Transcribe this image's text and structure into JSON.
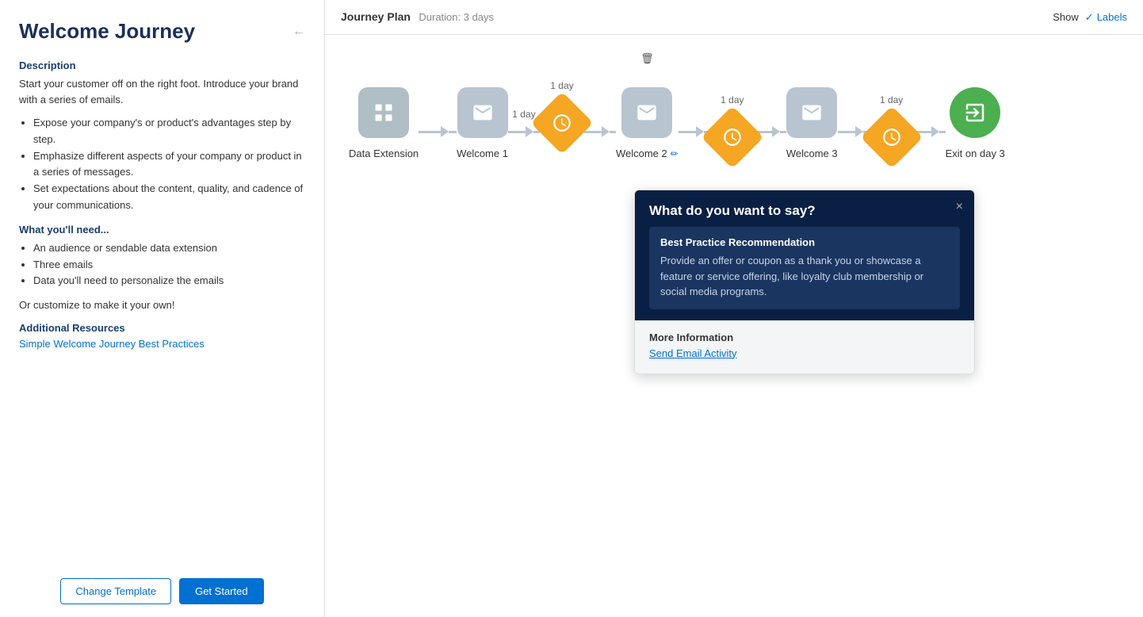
{
  "leftPanel": {
    "title": "Welcome Journey",
    "backArrow": "←",
    "descriptionHeading": "Description",
    "descriptionText": "Start your customer off on the right foot. Introduce your brand with a series of emails.",
    "bullets": [
      "Expose your company's or product's advantages step by step.",
      "Emphasize different aspects of your company or product in a series of messages.",
      "Set expectations about the content, quality, and cadence of your communications."
    ],
    "whatYoullNeed": "What you'll need...",
    "needsBullets": [
      "An audience or sendable data extension",
      "Three emails",
      "Data you'll need to personalize the emails"
    ],
    "customizeText": "Or customize to make it your own!",
    "additionalResourcesHeading": "Additional Resources",
    "resourceLink": "Simple Welcome Journey Best Practices",
    "changeTemplateLabel": "Change Template",
    "getStartedLabel": "Get Started"
  },
  "header": {
    "journeyPlanLabel": "Journey Plan",
    "durationLabel": "Duration: 3 days",
    "showLabel": "Show",
    "labelsLabel": "Labels"
  },
  "flow": {
    "nodes": [
      {
        "id": "data-extension",
        "type": "gray",
        "label": "Data Extension",
        "dayAbove": ""
      },
      {
        "id": "welcome-1",
        "type": "email",
        "label": "Welcome 1",
        "dayAbove": ""
      },
      {
        "id": "wait-1",
        "type": "diamond",
        "label": "",
        "dayAbove": "1 day"
      },
      {
        "id": "welcome-2",
        "type": "email",
        "label": "Welcome 2",
        "dayAbove": "",
        "editable": true,
        "hasDelete": true
      },
      {
        "id": "wait-2",
        "type": "diamond",
        "label": "",
        "dayAbove": "1 day"
      },
      {
        "id": "welcome-3",
        "type": "email",
        "label": "Welcome 3",
        "dayAbove": ""
      },
      {
        "id": "wait-3",
        "type": "diamond",
        "label": "",
        "dayAbove": "1 day"
      },
      {
        "id": "exit",
        "type": "exit",
        "label": "Exit on day 3",
        "dayAbove": ""
      }
    ]
  },
  "tooltip": {
    "title": "What do you want to say?",
    "bestPracticeTitle": "Best Practice Recommendation",
    "bestPracticeText": "Provide an offer or coupon as a thank you or showcase a feature or service offering, like loyalty club membership or social media programs.",
    "moreInfoLabel": "More Information",
    "moreInfoLink": "Send Email Activity",
    "closeLabel": "×"
  }
}
